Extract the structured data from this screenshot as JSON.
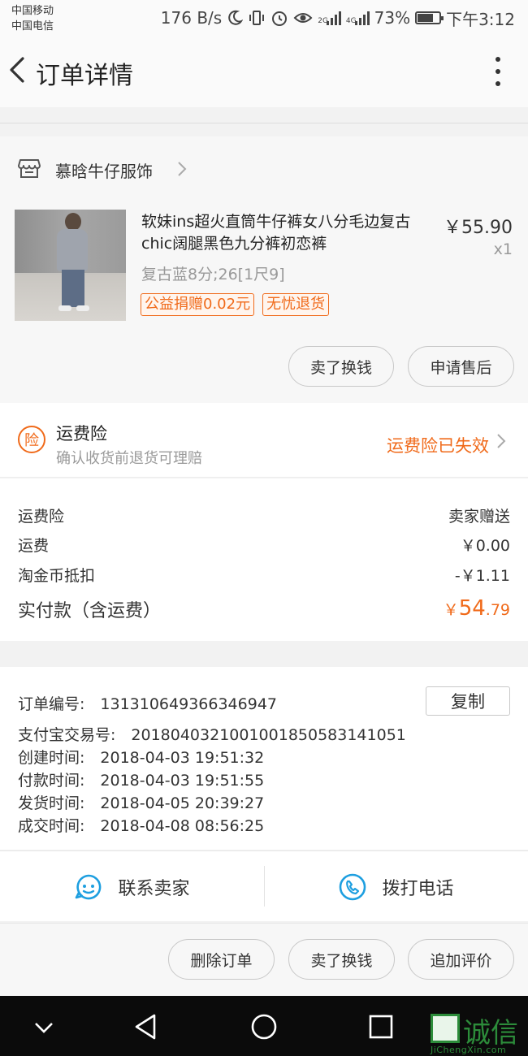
{
  "status_bar": {
    "carrier_1": "中国移动",
    "carrier_2": "中国电信",
    "net_speed": "176 B/s",
    "sig1_tag": "2G",
    "sig2_tag": "4G",
    "battery_level": 0.73,
    "battery": "73%",
    "time": "下午3:12"
  },
  "header": {
    "title": "订单详情"
  },
  "shop": {
    "name": "慕晗牛仔服饰"
  },
  "product": {
    "title": "软妹ins超火直筒牛仔裤女八分毛边复古chic阔腿黑色九分裤初恋裤",
    "price": "￥55.90",
    "quantity": "x1",
    "sku": "复古蓝8分;26[1尺9]",
    "tags": [
      "公益捐赠0.02元",
      "无忧退货"
    ],
    "buttons": [
      "卖了换钱",
      "申请售后"
    ]
  },
  "insurance": {
    "icon_char": "险",
    "title": "运费险",
    "subtitle": "确认收货前退货可理赔",
    "status": "运费险已失效"
  },
  "fees": [
    {
      "label": "运费险",
      "value": "卖家赠送"
    },
    {
      "label": "运费",
      "value": "￥0.00"
    },
    {
      "label": "淘金币抵扣",
      "value": "-￥1.11"
    }
  ],
  "total": {
    "label": "实付款（含运费）",
    "currency": "￥",
    "integer": "54",
    "decimal": ".79"
  },
  "order_info": {
    "copy_label": "复制",
    "rows": [
      "订单编号:　131310649366346947",
      "支付宝交易号:　2018040321001001850583141051",
      "创建时间:　2018-04-03 19:51:32",
      "付款时间:　2018-04-03 19:51:55",
      "发货时间:　2018-04-05 20:39:27",
      "成交时间:　2018-04-08 08:56:25"
    ]
  },
  "contact": {
    "seller": "联系卖家",
    "phone": "拨打电话"
  },
  "actions": [
    "删除订单",
    "卖了换钱",
    "追加评价"
  ],
  "watermark": {
    "text": "诚信",
    "sub": "JiChengXin.com"
  },
  "colors": {
    "accent": "#f06a1a",
    "icon_blue": "#1e9fe0"
  }
}
